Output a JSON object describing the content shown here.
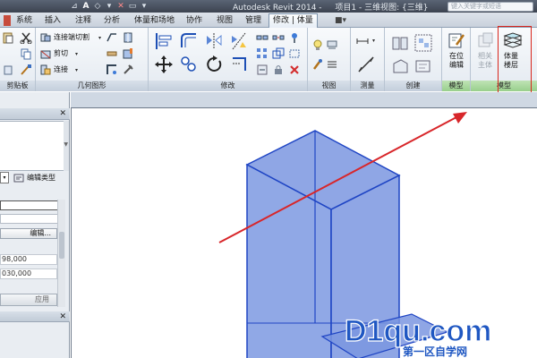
{
  "titlebar": {
    "app_title": "Autodesk Revit 2014 -",
    "doc_title": "项目1 - 三维视图: {三维}",
    "search_placeholder": "键入关键字或短语"
  },
  "tabs": [
    {
      "label": "系统"
    },
    {
      "label": "插入"
    },
    {
      "label": "注释"
    },
    {
      "label": "分析"
    },
    {
      "label": "体量和场地"
    },
    {
      "label": "协作"
    },
    {
      "label": "视图"
    },
    {
      "label": "管理"
    },
    {
      "label": "修改 | 体量",
      "active": true
    },
    {
      "label": "■▾"
    }
  ],
  "ribbon": {
    "panels": {
      "clipboard": "剪贴板",
      "geometry": "几何图形",
      "modify": "修改",
      "view": "视图",
      "measure": "测量",
      "create": "创建",
      "model": "模型",
      "model2": "模型"
    },
    "geometry": {
      "join_cut": "连接端切割",
      "cut": "剪切",
      "join": "连接"
    },
    "model": {
      "in_place_line1": "在位",
      "in_place_line2": "编辑",
      "host_line1": "相关",
      "host_line2": "主体",
      "floors_line1": "体量",
      "floors_line2": "楼层"
    }
  },
  "left_pane": {
    "edit_type": "编辑类型",
    "edit_button": "编辑...",
    "value1": "98,000",
    "value2": "030,000",
    "apply": "应用",
    "close_glyph": "✕"
  },
  "watermark": {
    "brand": "D1qu.com",
    "tagline": "第一区自学网"
  },
  "colors": {
    "mass_fill": "#7b97e0",
    "mass_edge": "#1f45c4",
    "arrow": "#d8262a",
    "highlight_box": "#d9261c"
  },
  "icons": [
    "quick-access-icons",
    "cut-icon",
    "join-icon",
    "move-icon",
    "rotate-icon",
    "array-icon",
    "mirror-icon",
    "delete-icon",
    "measure-icon",
    "create-group-icon",
    "in-place-edit-icon",
    "pick-host-icon",
    "mass-floors-icon",
    "edit-type-icon"
  ]
}
